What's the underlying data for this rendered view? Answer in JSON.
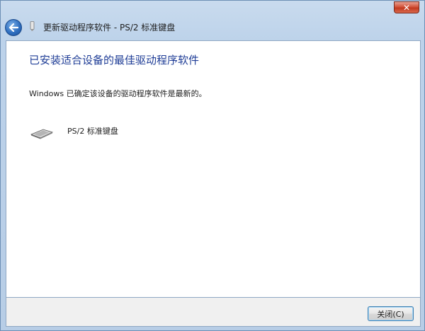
{
  "window": {
    "title": "更新驱动程序软件 - PS/2 标准键盘",
    "close_glyph": "✕"
  },
  "content": {
    "heading": "已安装适合设备的最佳驱动程序软件",
    "message": "Windows 已确定该设备的驱动程序软件是最新的。",
    "device_name": "PS/2 标准键盘"
  },
  "footer": {
    "close_label": "关闭(C)"
  },
  "icons": {
    "back": "back-arrow-icon",
    "device": "keyboard-icon",
    "title": "device-icon"
  },
  "colors": {
    "heading": "#1e3c96",
    "close_button": "#c23a1f",
    "frame": "#bcd2ea"
  }
}
